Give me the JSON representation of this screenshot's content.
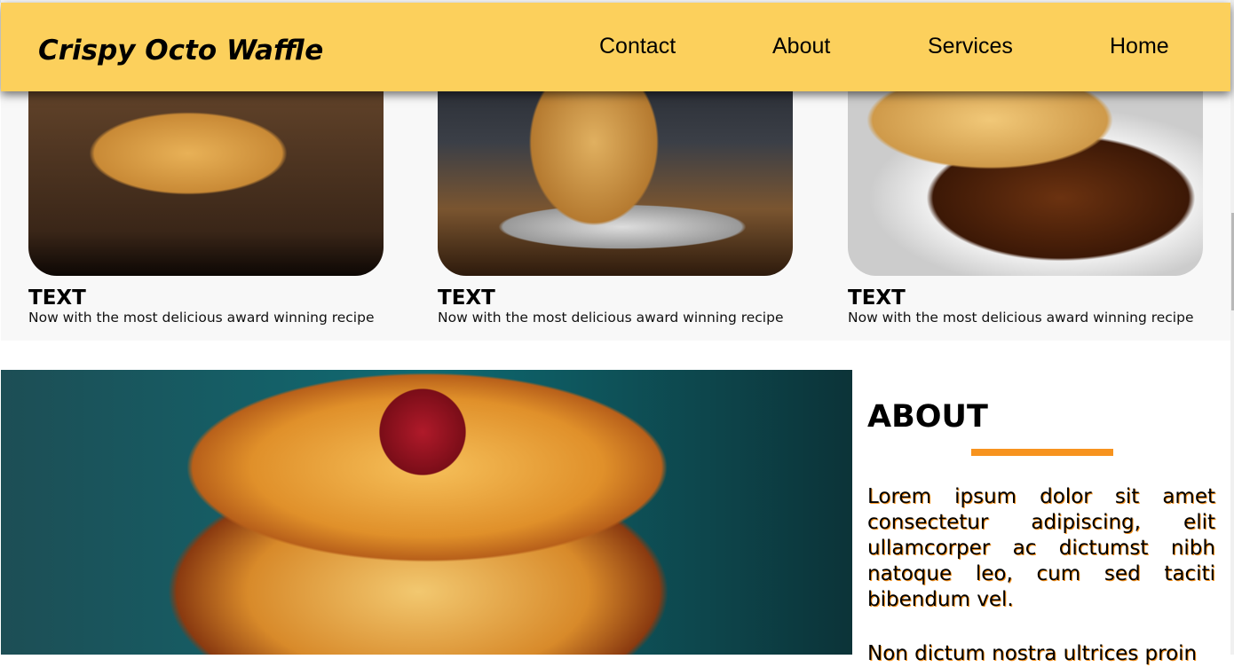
{
  "header": {
    "brand": "Crispy Octo Waffle",
    "nav": [
      "Contact",
      "About",
      "Services",
      "Home"
    ]
  },
  "cards": [
    {
      "title": "TEXT",
      "text": "Now with the most delicious award winning recipe"
    },
    {
      "title": "TEXT",
      "text": "Now with the most delicious award winning recipe"
    },
    {
      "title": "TEXT",
      "text": "Now with the most delicious award winning recipe"
    }
  ],
  "about": {
    "title": "ABOUT",
    "p1": "Lorem ipsum dolor sit amet consectetur adipiscing, elit ullamcorper ac dictumst nibh natoque leo, cum sed taciti bibendum vel.",
    "p2": "Non dictum nostra ultrices proin"
  },
  "colors": {
    "header": "#fcd05c",
    "accent": "#f7931e"
  }
}
